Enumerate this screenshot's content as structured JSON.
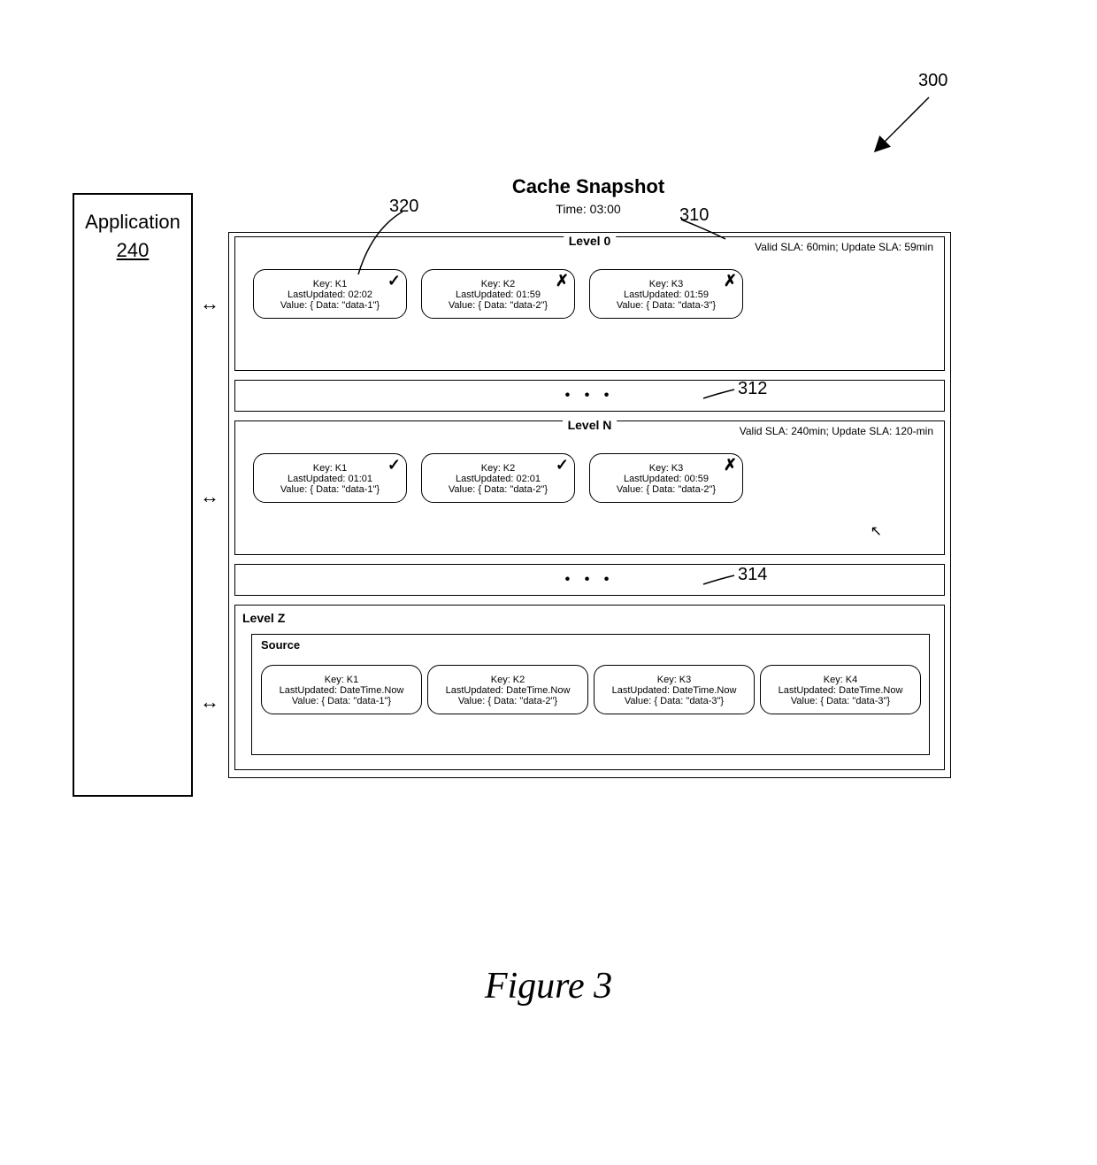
{
  "figure": {
    "caption": "Figure 3",
    "number_callout": "300"
  },
  "application_box": {
    "label": "Application",
    "number": "240"
  },
  "snapshot": {
    "title": "Cache Snapshot",
    "time": "Time: 03:00"
  },
  "callouts": {
    "c320": "320",
    "c310": "310",
    "c312": "312",
    "c314": "314"
  },
  "levels": {
    "level0": {
      "title": "Level 0",
      "sla": "Valid SLA: 60min; Update SLA: 59min",
      "cells": [
        {
          "key": "Key: K1",
          "updated": "LastUpdated: 02:02",
          "value": "Value: { Data: \"data-1\"}",
          "status": "check"
        },
        {
          "key": "Key: K2",
          "updated": "LastUpdated: 01:59",
          "value": "Value: { Data: \"data-2\"}",
          "status": "cross"
        },
        {
          "key": "Key: K3",
          "updated": "LastUpdated: 01:59",
          "value": "Value: { Data: \"data-3\"}",
          "status": "cross"
        }
      ]
    },
    "levelN": {
      "title": "Level N",
      "sla": "Valid SLA: 240min; Update SLA: 120-min",
      "cells": [
        {
          "key": "Key: K1",
          "updated": "LastUpdated: 01:01",
          "value": "Value: { Data: \"data-1\"}",
          "status": "check"
        },
        {
          "key": "Key: K2",
          "updated": "LastUpdated: 02:01",
          "value": "Value: { Data: \"data-2\"}",
          "status": "check"
        },
        {
          "key": "Key: K3",
          "updated": "LastUpdated: 00:59",
          "value": "Value: { Data: \"data-2\"}",
          "status": "cross"
        }
      ]
    },
    "levelZ": {
      "title": "Level Z",
      "source_label": "Source",
      "cells": [
        {
          "key": "Key: K1",
          "updated": "LastUpdated: DateTime.Now",
          "value": "Value: { Data: \"data-1\"}"
        },
        {
          "key": "Key: K2",
          "updated": "LastUpdated: DateTime.Now",
          "value": "Value: { Data: \"data-2\"}"
        },
        {
          "key": "Key: K3",
          "updated": "LastUpdated: DateTime.Now",
          "value": "Value: { Data: \"data-3\"}"
        },
        {
          "key": "Key: K4",
          "updated": "LastUpdated: DateTime.Now",
          "value": "Value: { Data: \"data-3\"}"
        }
      ]
    }
  },
  "marks": {
    "check": "✓",
    "cross": "✗"
  },
  "ellipsis": "• • •"
}
